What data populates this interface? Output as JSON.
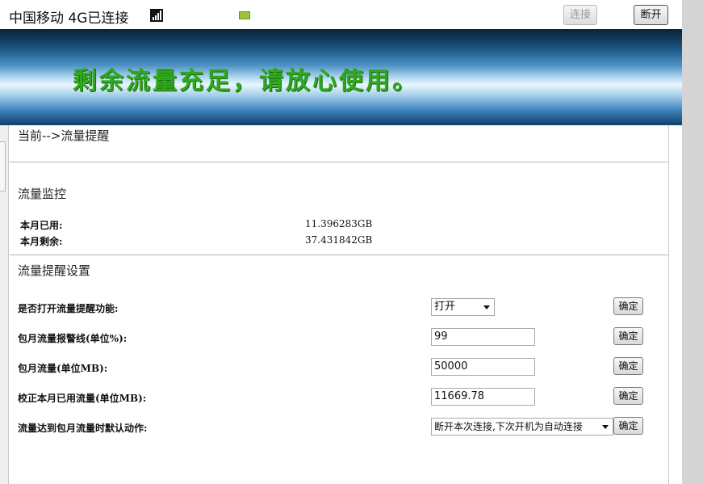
{
  "status_bar": {
    "operator_status": "中国移动 4G已连接",
    "signal_icon": "signal-strength-icon",
    "battery_icon": "battery-icon",
    "connect_label": "连接",
    "disconnect_label": "断开"
  },
  "banner": {
    "message": "剩余流量充足，请放心使用。",
    "text_color": "#2fa81e"
  },
  "breadcrumb": "当前-->流量提醒",
  "monitor": {
    "title": "流量监控",
    "used_label": "本月已用:",
    "used_value": "11.396283GB",
    "remaining_label": "本月剩余:",
    "remaining_value": "37.431842GB"
  },
  "settings": {
    "title": "流量提醒设置",
    "confirm_label": "确定",
    "rows": [
      {
        "label": "是否打开流量提醒功能:",
        "value": "打开"
      },
      {
        "label": "包月流量报警线(单位%):",
        "value": "99"
      },
      {
        "label": "包月流量(单位MB):",
        "value": "50000"
      },
      {
        "label": "校正本月已用流量(单位MB):",
        "value": "11669.78"
      },
      {
        "label": "流量达到包月流量时默认动作:",
        "value": "断开本次连接,下次开机为自动连接"
      }
    ]
  }
}
